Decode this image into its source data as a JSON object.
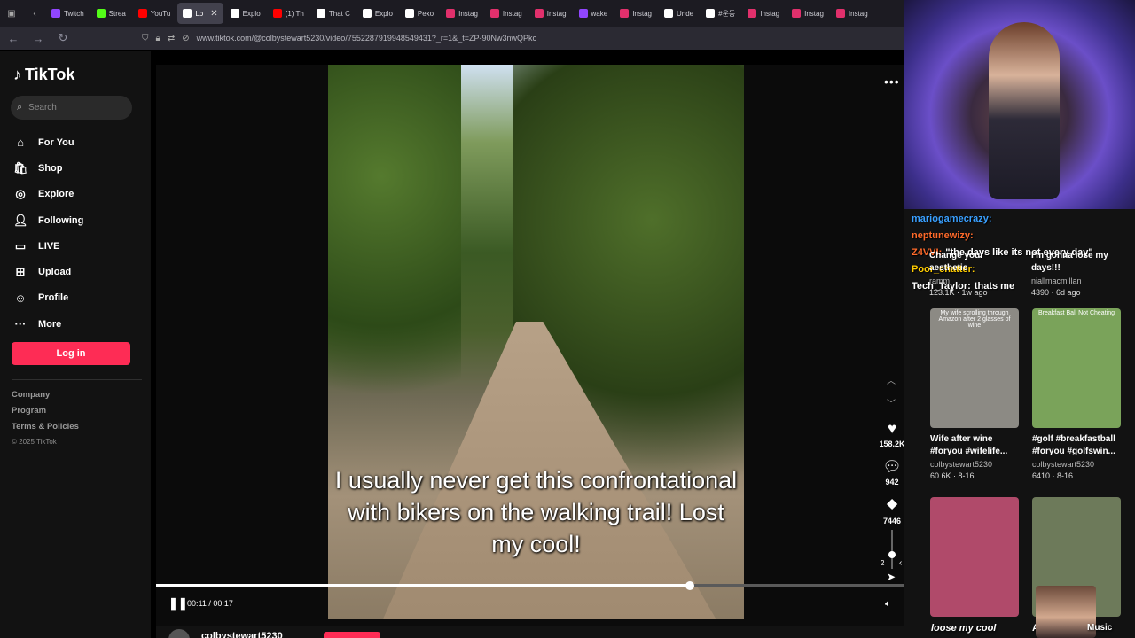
{
  "browser": {
    "tabs": [
      {
        "label": "Twitch",
        "color": "#9146ff"
      },
      {
        "label": "Strea",
        "color": "#53fc18"
      },
      {
        "label": "YouTu",
        "color": "#ff0000"
      },
      {
        "label": "Lo",
        "color": "#ffffff",
        "active": true
      },
      {
        "label": "Explo",
        "color": "#ffffff"
      },
      {
        "label": "(1) Th",
        "color": "#ff0000"
      },
      {
        "label": "That C",
        "color": "#ffffff"
      },
      {
        "label": "Explo",
        "color": "#ffffff"
      },
      {
        "label": "Pexo",
        "color": "#ffffff"
      },
      {
        "label": "Instag",
        "color": "#e1306c"
      },
      {
        "label": "Instag",
        "color": "#e1306c"
      },
      {
        "label": "Instag",
        "color": "#e1306c"
      },
      {
        "label": "wake",
        "color": "#9146ff"
      },
      {
        "label": "Instag",
        "color": "#e1306c"
      },
      {
        "label": "Unde",
        "color": "#ffffff"
      },
      {
        "label": "#운동",
        "color": "#ffffff"
      },
      {
        "label": "Instag",
        "color": "#e1306c"
      },
      {
        "label": "Instag",
        "color": "#e1306c"
      },
      {
        "label": "Instag",
        "color": "#e1306c"
      }
    ],
    "url": "www.tiktok.com/@colbystewart5230/video/7552287919948549431?_r=1&_t=ZP-90Nw3nwQPkc"
  },
  "sidebar": {
    "logo": "TikTok",
    "search_placeholder": "Search",
    "nav": [
      {
        "label": "For You",
        "icon": "home-icon"
      },
      {
        "label": "Shop",
        "icon": "shop-icon"
      },
      {
        "label": "Explore",
        "icon": "compass-icon"
      },
      {
        "label": "Following",
        "icon": "following-icon"
      },
      {
        "label": "LIVE",
        "icon": "live-icon"
      },
      {
        "label": "Upload",
        "icon": "upload-icon"
      },
      {
        "label": "Profile",
        "icon": "profile-icon"
      },
      {
        "label": "More",
        "icon": "more-icon"
      }
    ],
    "login_label": "Log in",
    "footer": [
      "Company",
      "Program",
      "Terms & Policies"
    ],
    "copyright": "© 2025 TikTok"
  },
  "video": {
    "caption": "I usually never get this confrontational with bikers on the walking trail!  Lost my cool!",
    "likes": "158.2K",
    "comments": "942",
    "saves": "7446",
    "volume_indicator": "2",
    "time": "00:11 / 00:17",
    "progress": 0.713,
    "author": "colbystewart5230"
  },
  "right": {
    "chat": [
      {
        "user": "mariogamecrazy:",
        "color": "#3aa0ff",
        "text": ""
      },
      {
        "user": "neptunewizy:",
        "color": "#ff6a2a",
        "text": ""
      },
      {
        "user": "Z4VVI:",
        "color": "#ff6a2a",
        "text": "\"the days like its not every day\""
      },
      {
        "user": "Poor_chatter:",
        "color": "#ffcc00",
        "text": ""
      },
      {
        "user": "Tech_Taylor:",
        "color": "#ffffff",
        "text": "thats me"
      }
    ],
    "top_cards": [
      {
        "desc": "Change your aesthetic",
        "meta": "ramm",
        "stats": "123.1K · 1w ago"
      },
      {
        "desc": "I'm gonna lose my days!!!",
        "meta": "niallmacmillan",
        "stats": "4390 · 6d ago"
      }
    ],
    "cards": [
      {
        "thumb_title": "My wife scrolling through Amazon after 2 glasses of wine",
        "desc": "Wife after wine #foryou #wifelife...",
        "author": "colbystewart5230",
        "stats": "60.6K · 8-16",
        "bg": "#8c8a84"
      },
      {
        "thumb_title": "Breakfast Ball Not Cheating",
        "desc": "#golf #breakfastball #foryou #golfswin...",
        "author": "colbystewart5230",
        "stats": "6410 · 8-16",
        "bg": "#7aa35a"
      }
    ],
    "bottom_cards": [
      {
        "overlay": "loose my cool",
        "bg": "#b04a6a"
      },
      {
        "overlay": "A",
        "bg": "#6d7a5a"
      }
    ],
    "bottom_right_label": "Music"
  }
}
